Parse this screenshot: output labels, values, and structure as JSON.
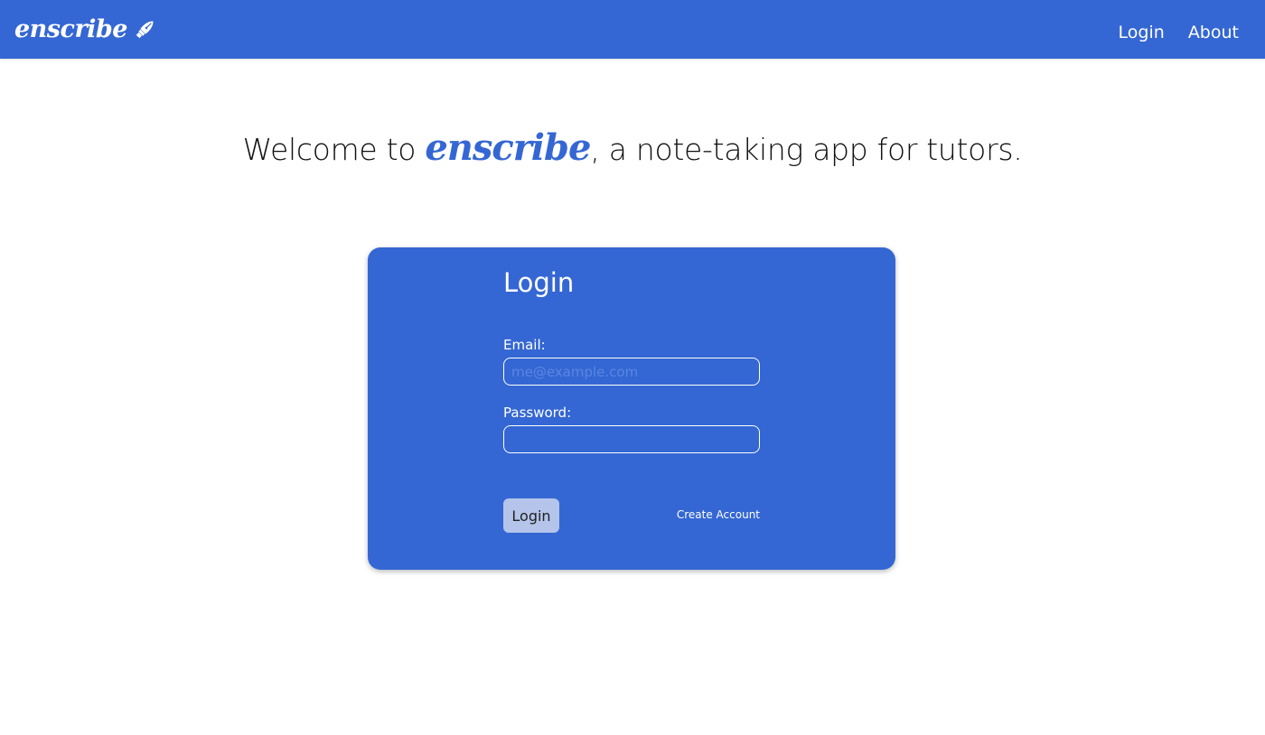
{
  "navbar": {
    "brand": "enscribe",
    "brand_icon": "fountain-pen-icon",
    "links": [
      {
        "label": "Login"
      },
      {
        "label": "About"
      }
    ],
    "color": "#3467d3"
  },
  "hero": {
    "prefix": "Welcome to ",
    "brand": "enscribe",
    "suffix": ", a note-taking app for tutors."
  },
  "login_form": {
    "title": "Login",
    "email_label": "Email:",
    "email_value": "",
    "email_placeholder": "me@example.com",
    "password_label": "Password:",
    "password_value": "",
    "submit_label": "Login",
    "create_account_label": "Create Account"
  },
  "colors": {
    "primary": "#3467d3",
    "button_bg": "#b4c4ea",
    "text_on_primary": "#ffffff"
  }
}
